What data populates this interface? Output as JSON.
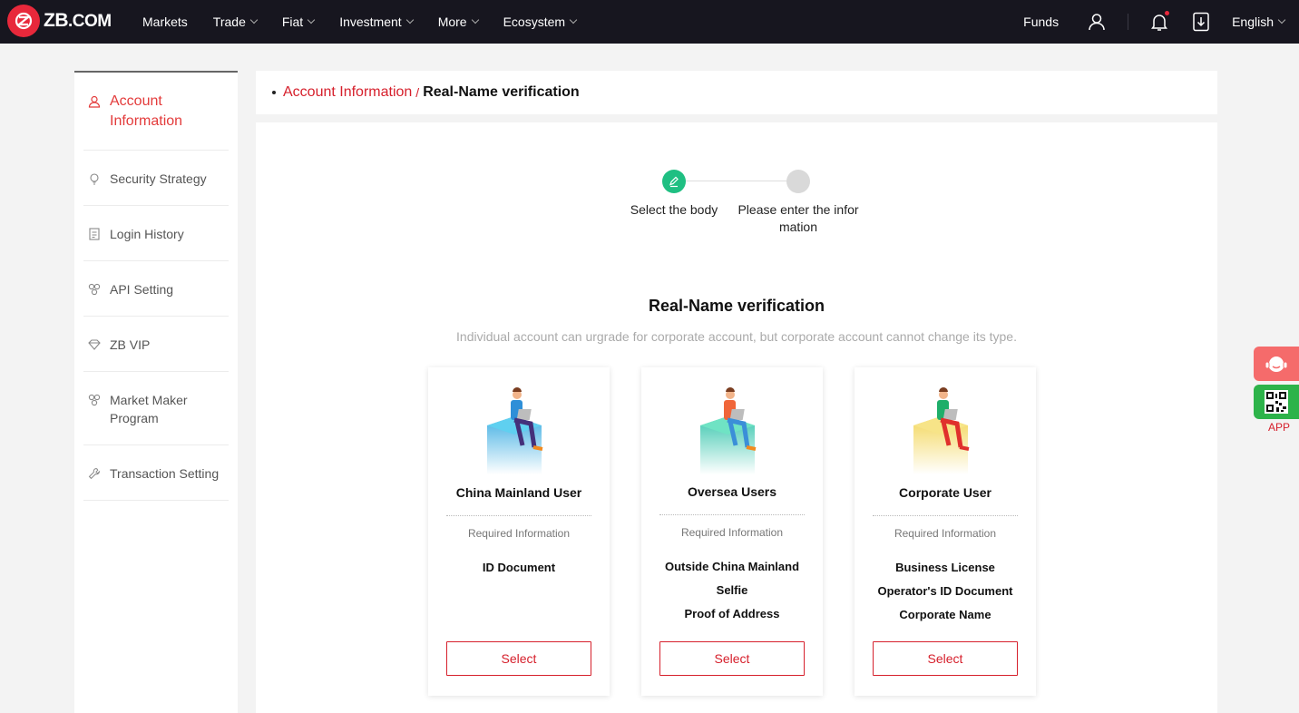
{
  "brand": {
    "logo_text": "ZB",
    "logo_suffix": ".COM"
  },
  "nav": {
    "items": [
      {
        "label": "Markets",
        "dropdown": false
      },
      {
        "label": "Trade",
        "dropdown": true
      },
      {
        "label": "Fiat",
        "dropdown": true
      },
      {
        "label": "Investment",
        "dropdown": true
      },
      {
        "label": "More",
        "dropdown": true
      },
      {
        "label": "Ecosystem",
        "dropdown": true
      }
    ],
    "funds": "Funds",
    "language": "English"
  },
  "sidebar": {
    "items": [
      {
        "label": "Account Information",
        "icon": "user-icon",
        "active": true
      },
      {
        "label": "Security Strategy",
        "icon": "lightbulb-icon",
        "active": false
      },
      {
        "label": "Login History",
        "icon": "document-icon",
        "active": false
      },
      {
        "label": "API Setting",
        "icon": "api-icon",
        "active": false
      },
      {
        "label": "ZB VIP",
        "icon": "diamond-icon",
        "active": false
      },
      {
        "label": "Market Maker Program",
        "icon": "market-maker-icon",
        "active": false
      },
      {
        "label": "Transaction Setting",
        "icon": "wrench-icon",
        "active": false
      }
    ]
  },
  "breadcrumb": {
    "parent": "Account Information",
    "separator": "/",
    "current": "Real-Name verification"
  },
  "steps": [
    {
      "label": "Select the body",
      "state": "active"
    },
    {
      "label": "Please enter the infor mation",
      "state": "pending"
    }
  ],
  "section": {
    "title": "Real-Name verification",
    "subtitle": "Individual account can urgrade for corporate account, but corporate account cannot change its type."
  },
  "cards": [
    {
      "title": "China Mainland User",
      "required_label": "Required Information",
      "requirements": [
        "ID Document"
      ],
      "button": "Select",
      "accent": "#2ea7e0"
    },
    {
      "title": "Oversea Users",
      "required_label": "Required Information",
      "requirements": [
        "Outside China Mainland",
        "Selfie",
        "Proof of Address"
      ],
      "button": "Select",
      "accent": "#27c1a6"
    },
    {
      "title": "Corporate User",
      "required_label": "Required Information",
      "requirements": [
        "Business License",
        "Operator's ID Document",
        "Corporate Name"
      ],
      "button": "Select",
      "accent": "#f2d24a"
    }
  ],
  "floating": {
    "app_label": "APP"
  },
  "colors": {
    "brand_red": "#e8283b",
    "link_red": "#d6202c",
    "step_green": "#1fbf82",
    "nav_bg": "#17161f"
  }
}
